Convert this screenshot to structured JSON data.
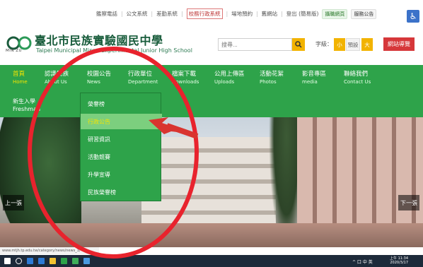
{
  "top_links": {
    "items": [
      "鑑察電話",
      "公文系統",
      "差勤系統",
      "校務行政系統",
      "場地預約",
      "舊網站",
      "登出 (簡易版)"
    ],
    "pill1": "攝職網頁",
    "pill2": "服務公告"
  },
  "header": {
    "brand": "MIN ZU",
    "title_zh": "臺北市民族實驗國民中學",
    "title_en": "Taipei Municipal Minzu Experimental Junior High School",
    "search_placeholder": "搜尋...",
    "fontsize_label": "字級：",
    "font_small": "小",
    "font_default": "預設",
    "font_large": "大",
    "guide_button": "網站導覽"
  },
  "nav": {
    "items": [
      {
        "zh": "首頁",
        "en": "Home"
      },
      {
        "zh": "認識民族",
        "en": "About Us"
      },
      {
        "zh": "校園公告",
        "en": "News"
      },
      {
        "zh": "行政單位",
        "en": "Department"
      },
      {
        "zh": "檔案下載",
        "en": "Downloads"
      },
      {
        "zh": "公用上傳區",
        "en": "Uploads"
      },
      {
        "zh": "活動花絮",
        "en": "Photos"
      },
      {
        "zh": "影音專區",
        "en": "media"
      },
      {
        "zh": "聯絡我們",
        "en": "Contact Us"
      }
    ],
    "sub_item_zh": "新生入學",
    "sub_item_en": "Freshman"
  },
  "dropdown": {
    "items": [
      "榮譽榜",
      "行政公告",
      "研習資訊",
      "活動競賽",
      "升學宣導",
      "民族榮譽榜"
    ],
    "selected": "行政公告"
  },
  "hero": {
    "prev": "上一張",
    "next": "下一張"
  },
  "status_url": "www.mtjh.tp.edu.tw/category/news/news_1/",
  "taskbar": {
    "time": "上午 11:34",
    "date": "2020/3/17",
    "tray": "^ 口 中 英"
  },
  "colors": {
    "nav_green": "#2ea34a",
    "accent_yellow": "#f2b300",
    "guide_red": "#d6373a",
    "annotation_red": "#e8232d"
  }
}
